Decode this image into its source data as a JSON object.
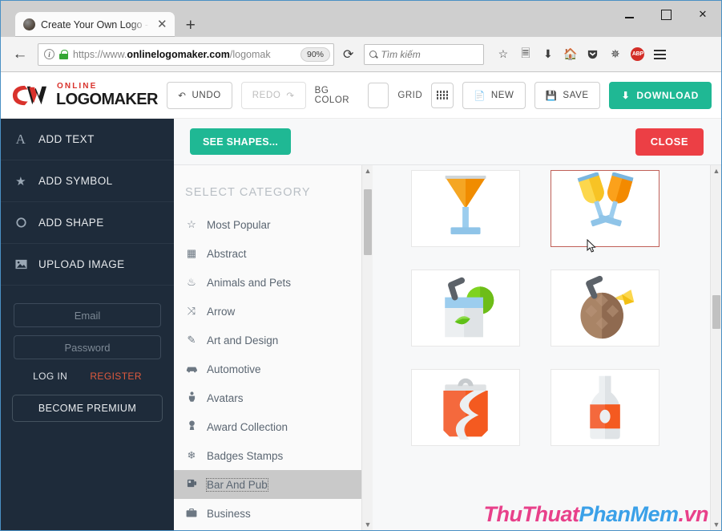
{
  "browser": {
    "tab": {
      "title": "Create Your Own Logo - Onl",
      "close_label": "✕"
    },
    "new_tab_label": "+",
    "window_controls": {
      "minimize": "",
      "maximize": "",
      "close": "✕"
    },
    "back_label": "←",
    "url": {
      "prefix": "https://www.",
      "domain": "onlinelogomaker.com",
      "path": "/logomak"
    },
    "zoom": "90%",
    "reload_label": "⟳",
    "search": {
      "placeholder": "Tìm kiếm",
      "icon": "search-icon"
    },
    "toolbar_icons": [
      "bookmark-star-icon",
      "library-icon",
      "downloads-icon",
      "home-icon",
      "pocket-icon",
      "screenshot-icon",
      "adblock-plus-icon",
      "menu-icon"
    ],
    "adblock_label": "ABP"
  },
  "app_header": {
    "brand": {
      "online": "ONLINE",
      "logomaker": "LOGOMAKER"
    },
    "undo": "UNDO",
    "redo": "REDO",
    "bg_color_label": "BG COLOR",
    "bg_color_value": "#ffffff",
    "grid_label": "GRID",
    "new": "NEW",
    "save": "SAVE",
    "download": "DOWNLOAD"
  },
  "sidebar": {
    "items": [
      {
        "label": "ADD TEXT",
        "icon": "text-icon",
        "glyph": "A"
      },
      {
        "label": "ADD SYMBOL",
        "icon": "star-icon",
        "glyph": "★"
      },
      {
        "label": "ADD SHAPE",
        "icon": "circle-icon",
        "glyph": "○"
      },
      {
        "label": "UPLOAD IMAGE",
        "icon": "image-icon",
        "glyph": "Ὓc"
      }
    ],
    "email_placeholder": "Email",
    "password_placeholder": "Password",
    "login": "LOG IN",
    "register": "REGISTER",
    "premium": "BECOME PREMIUM"
  },
  "modal": {
    "see_shapes": "SEE SHAPES...",
    "close": "CLOSE",
    "category_header": "SELECT CATEGORY",
    "categories": [
      {
        "label": "Most Popular",
        "icon": "star-outline-icon",
        "glyph": "☆",
        "active": false
      },
      {
        "label": "Abstract",
        "icon": "abstract-icon",
        "glyph": "▟",
        "active": false
      },
      {
        "label": "Animals and Pets",
        "icon": "paw-icon",
        "glyph": "ὃe",
        "active": false
      },
      {
        "label": "Arrow",
        "icon": "arrows-icon",
        "glyph": "⤨",
        "active": false
      },
      {
        "label": "Art and Design",
        "icon": "paintbrush-icon",
        "glyph": "✎",
        "active": false
      },
      {
        "label": "Automotive",
        "icon": "car-icon",
        "glyph": "Ὡ7",
        "active": false
      },
      {
        "label": "Avatars",
        "icon": "person-icon",
        "glyph": "὆4",
        "active": false
      },
      {
        "label": "Award Collection",
        "icon": "trophy-icon",
        "glyph": "Ἴ5",
        "active": false
      },
      {
        "label": "Badges Stamps",
        "icon": "badge-icon",
        "glyph": "⬟",
        "active": false
      },
      {
        "label": "Bar And Pub",
        "icon": "bar-pub-icon",
        "glyph": "ἷa",
        "active": true
      },
      {
        "label": "Business",
        "icon": "briefcase-icon",
        "glyph": "Ὃc",
        "active": false
      }
    ],
    "symbols": [
      [
        {
          "name": "cocktail-glass-symbol",
          "selected": false
        },
        {
          "name": "toasting-glasses-symbol",
          "selected": true
        }
      ],
      [
        {
          "name": "mojito-glass-symbol",
          "selected": false
        },
        {
          "name": "coconut-drink-symbol",
          "selected": false
        }
      ],
      [
        {
          "name": "soda-can-symbol",
          "selected": false
        },
        {
          "name": "bottle-symbol",
          "selected": false
        }
      ]
    ]
  },
  "watermark": {
    "part1": "ThuThuat",
    "part2": "PhanMem",
    "part3": ".vn"
  },
  "colors": {
    "accent_green": "#1fb894",
    "danger_red": "#ec3f45",
    "sidebar_navy": "#1e2b3a",
    "brand_red": "#d9322c",
    "register_orange": "#e05a3d"
  }
}
